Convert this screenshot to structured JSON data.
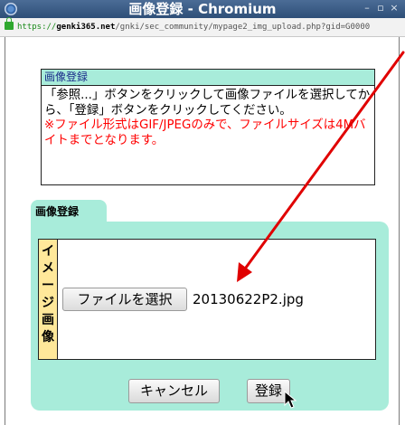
{
  "window": {
    "title": "画像登録 - Chromium",
    "minimize_glyph": "–",
    "maximize_glyph": "▫",
    "close_glyph": "×"
  },
  "urlbar": {
    "scheme": "https://",
    "host": "genki365.net",
    "path": "/gnki/sec_community/mypage2_img_upload.php?gid=G0000"
  },
  "info": {
    "heading": "画像登録",
    "instructions": "「参照...」ボタンをクリックして画像ファイルを選択してから、「登録」ボタンをクリックしてください。",
    "note": "※ファイル形式はGIF/JPEGのみで、ファイルサイズは4Mバイトまでとなります。"
  },
  "upload": {
    "tab_label": "画像登録",
    "side_label_chars": [
      "イ",
      "メ",
      "ー",
      "ジ",
      "画",
      "像"
    ],
    "choose_file_label": "ファイルを選択",
    "file_name": "20130622P2.jpg",
    "cancel_label": "キャンセル",
    "register_label": "登録"
  },
  "colors": {
    "panel_bg": "#a8ecda",
    "side_label_bg": "#ffe89a",
    "note_text": "#ff0000",
    "arrow": "#e00000",
    "heading_text": "#1a2b8a"
  },
  "icons": {
    "app": "chromium-icon",
    "lock": "lock-icon",
    "cursor": "mouse-pointer-icon",
    "annotation": "red-arrow"
  }
}
